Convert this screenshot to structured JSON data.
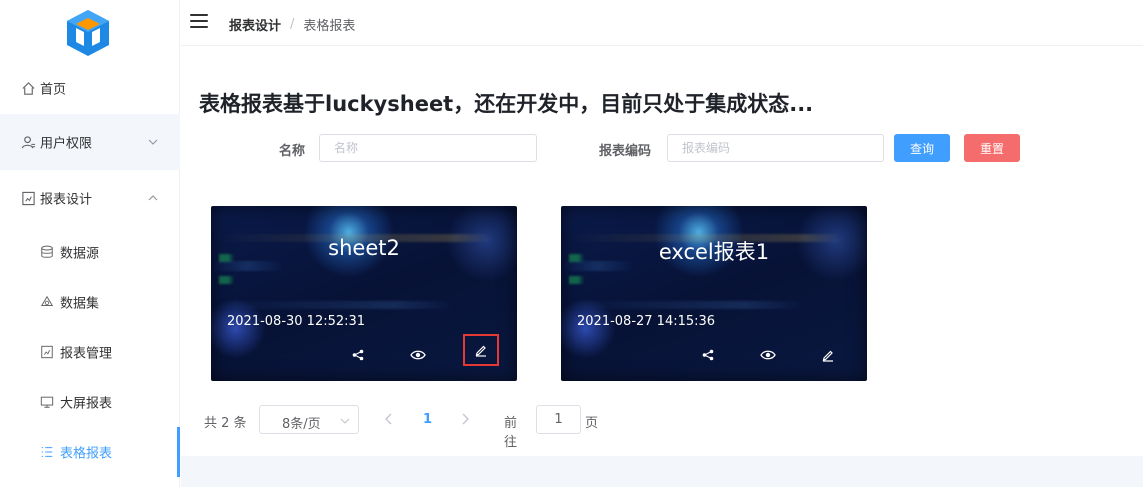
{
  "sidebar": {
    "items": [
      {
        "label": "首页",
        "icon": "home-icon"
      },
      {
        "label": "用户权限",
        "icon": "user-icon"
      },
      {
        "label": "报表设计",
        "icon": "report-design-icon"
      }
    ],
    "sub_items": [
      {
        "label": "数据源",
        "icon": "database-icon"
      },
      {
        "label": "数据集",
        "icon": "dataset-icon"
      },
      {
        "label": "报表管理",
        "icon": "report-manage-icon"
      },
      {
        "label": "大屏报表",
        "icon": "monitor-icon"
      },
      {
        "label": "表格报表",
        "icon": "list-icon",
        "active": true
      }
    ]
  },
  "breadcrumb": {
    "parent": "报表设计",
    "separator": "/",
    "current": "表格报表"
  },
  "page_title": "表格报表基于luckysheet，还在开发中，目前只处于集成状态...",
  "search": {
    "name_label": "名称",
    "name_placeholder": "名称",
    "code_label": "报表编码",
    "code_placeholder": "报表编码",
    "query_label": "查询",
    "reset_label": "重置"
  },
  "cards": [
    {
      "title": "sheet2",
      "date": "2021-08-30 12:52:31"
    },
    {
      "title": "excel报表1",
      "date": "2021-08-27 14:15:36"
    }
  ],
  "pagination": {
    "total": "共 2 条",
    "page_size": "8条/页",
    "current_page": "1",
    "goto_label": "前往",
    "goto_value": "1",
    "page_suffix": "页"
  },
  "colors": {
    "primary": "#409eff",
    "danger": "#f56c6c",
    "highlight": "#e53935"
  }
}
